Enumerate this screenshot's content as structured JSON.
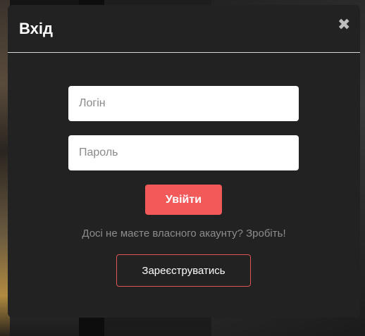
{
  "modal": {
    "title": "Вхід",
    "close_symbol": "✖",
    "close_icon": "close-icon"
  },
  "form": {
    "login_placeholder": "Логін",
    "login_value": "",
    "password_placeholder": "Пароль",
    "password_value": "",
    "submit_label": "Увійти",
    "no_account_hint": "Досі не маєте власного акаунту? Зробіть!",
    "register_label": "Зареєструватись"
  },
  "colors": {
    "modal_background": "#222222",
    "accent": "#f25a5a",
    "hint_text": "#8d8d8d"
  }
}
